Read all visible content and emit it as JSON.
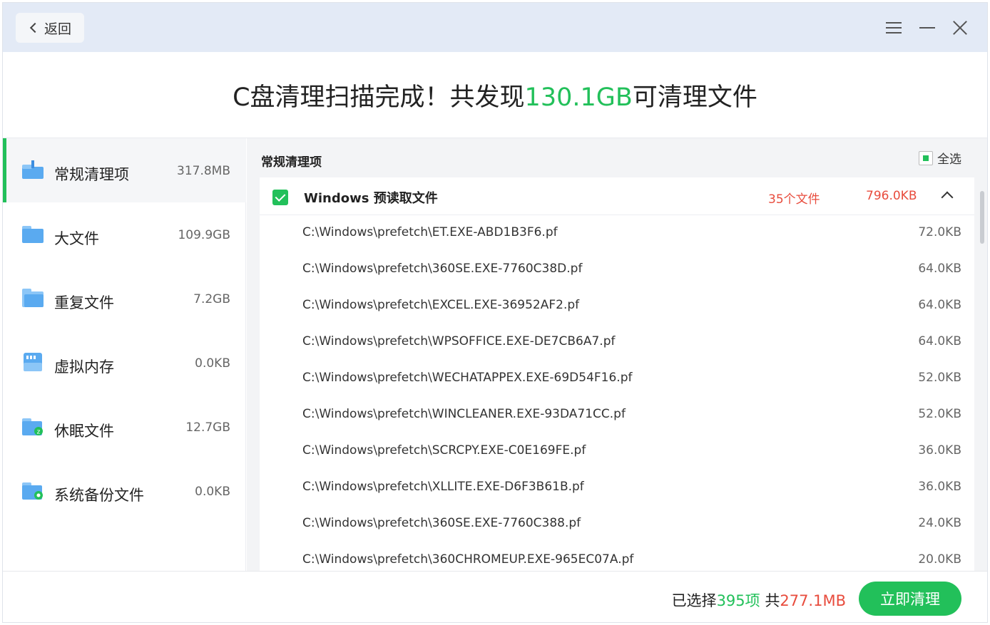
{
  "titlebar": {
    "back_label": "返回",
    "icons": {
      "back": "chevron-left-icon",
      "menu": "hamburger-menu-icon",
      "minimize": "minimize-icon",
      "close": "close-icon"
    }
  },
  "headline": {
    "prefix": "C盘清理扫描完成！共发现",
    "size": "130.1GB",
    "suffix": "可清理文件"
  },
  "sidebar": {
    "items": [
      {
        "label": "常规清理项",
        "size": "317.8MB",
        "icon": "broom-folder-icon",
        "active": true
      },
      {
        "label": "大文件",
        "size": "109.9GB",
        "icon": "folder-icon",
        "active": false
      },
      {
        "label": "重复文件",
        "size": "7.2GB",
        "icon": "duplicate-folder-icon",
        "active": false
      },
      {
        "label": "虚拟内存",
        "size": "0.0KB",
        "icon": "memory-icon",
        "active": false
      },
      {
        "label": "休眠文件",
        "size": "12.7GB",
        "icon": "sleep-folder-icon",
        "active": false
      },
      {
        "label": "系统备份文件",
        "size": "0.0KB",
        "icon": "backup-folder-icon",
        "active": false
      }
    ]
  },
  "main": {
    "section_title": "常规清理项",
    "select_all_label": "全选",
    "group": {
      "name": "Windows 预读取文件",
      "count": "35个文件",
      "size": "796.0KB",
      "files": [
        {
          "path": "C:\\Windows\\prefetch\\ET.EXE-ABD1B3F6.pf",
          "size": "72.0KB"
        },
        {
          "path": "C:\\Windows\\prefetch\\360SE.EXE-7760C38D.pf",
          "size": "64.0KB"
        },
        {
          "path": "C:\\Windows\\prefetch\\EXCEL.EXE-36952AF2.pf",
          "size": "64.0KB"
        },
        {
          "path": "C:\\Windows\\prefetch\\WPSOFFICE.EXE-DE7CB6A7.pf",
          "size": "64.0KB"
        },
        {
          "path": "C:\\Windows\\prefetch\\WECHATAPPEX.EXE-69D54F16.pf",
          "size": "52.0KB"
        },
        {
          "path": "C:\\Windows\\prefetch\\WINCLEANER.EXE-93DA71CC.pf",
          "size": "52.0KB"
        },
        {
          "path": "C:\\Windows\\prefetch\\SCRCPY.EXE-C0E169FE.pf",
          "size": "36.0KB"
        },
        {
          "path": "C:\\Windows\\prefetch\\XLLITE.EXE-D6F3B61B.pf",
          "size": "36.0KB"
        },
        {
          "path": "C:\\Windows\\prefetch\\360SE.EXE-7760C388.pf",
          "size": "24.0KB"
        },
        {
          "path": "C:\\Windows\\prefetch\\360CHROMEUP.EXE-965EC07A.pf",
          "size": "20.0KB"
        }
      ]
    }
  },
  "footer": {
    "selected_prefix": "已选择",
    "selected_count": "395项",
    "total_prefix": "共",
    "total_size": "277.1MB",
    "clean_button": "立即清理"
  },
  "colors": {
    "accent": "#22c05a",
    "warn": "#e84c3d",
    "titlebar": "#e3eaf6",
    "icon_blue": "#5aaaf0"
  }
}
